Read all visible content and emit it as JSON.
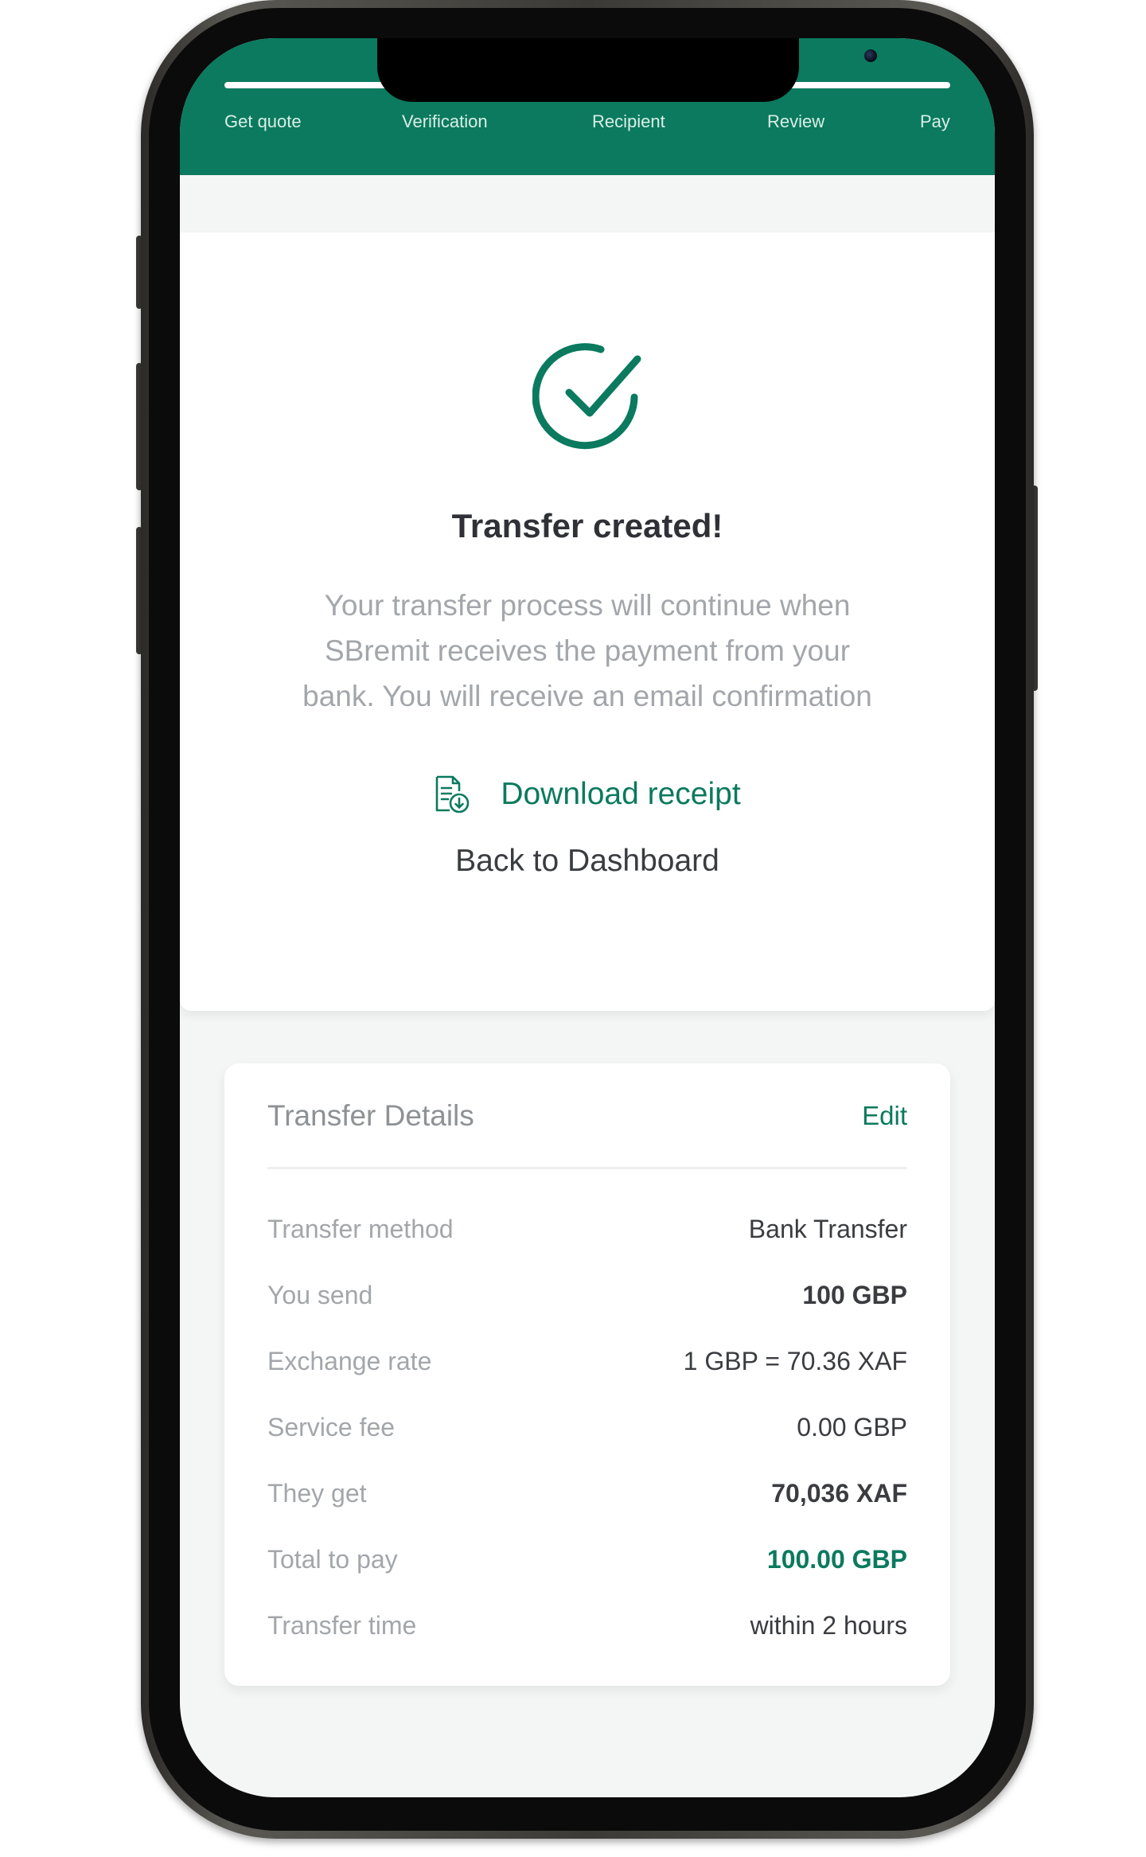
{
  "header": {
    "steps": [
      "Get quote",
      "Verification",
      "Recipient",
      "Review",
      "Pay"
    ]
  },
  "success": {
    "icon": "check-circle-icon",
    "title": "Transfer created!",
    "message_lines": [
      "Your transfer process will continue when",
      "SBremit receives the payment from your",
      "bank. You will receive an email confirmation"
    ],
    "download_label": "Download receipt",
    "back_label": "Back to Dashboard"
  },
  "details": {
    "title": "Transfer Details",
    "edit_label": "Edit",
    "rows": [
      {
        "label": "Transfer method",
        "value": "Bank Transfer"
      },
      {
        "label": "You send",
        "value": "100 GBP"
      },
      {
        "label": "Exchange rate",
        "value": "1 GBP = 70.36 XAF"
      },
      {
        "label": "Service fee",
        "value": "0.00 GBP"
      },
      {
        "label": "They get",
        "value": "70,036 XAF"
      },
      {
        "label": "Total to pay",
        "value": "100.00 GBP"
      },
      {
        "label": "Transfer time",
        "value": "within 2 hours"
      }
    ]
  },
  "colors": {
    "brand": "#0b7a5e",
    "background": "#f4f5f5",
    "muted_text": "#a3a6aa",
    "dark_text": "#2f3136"
  }
}
